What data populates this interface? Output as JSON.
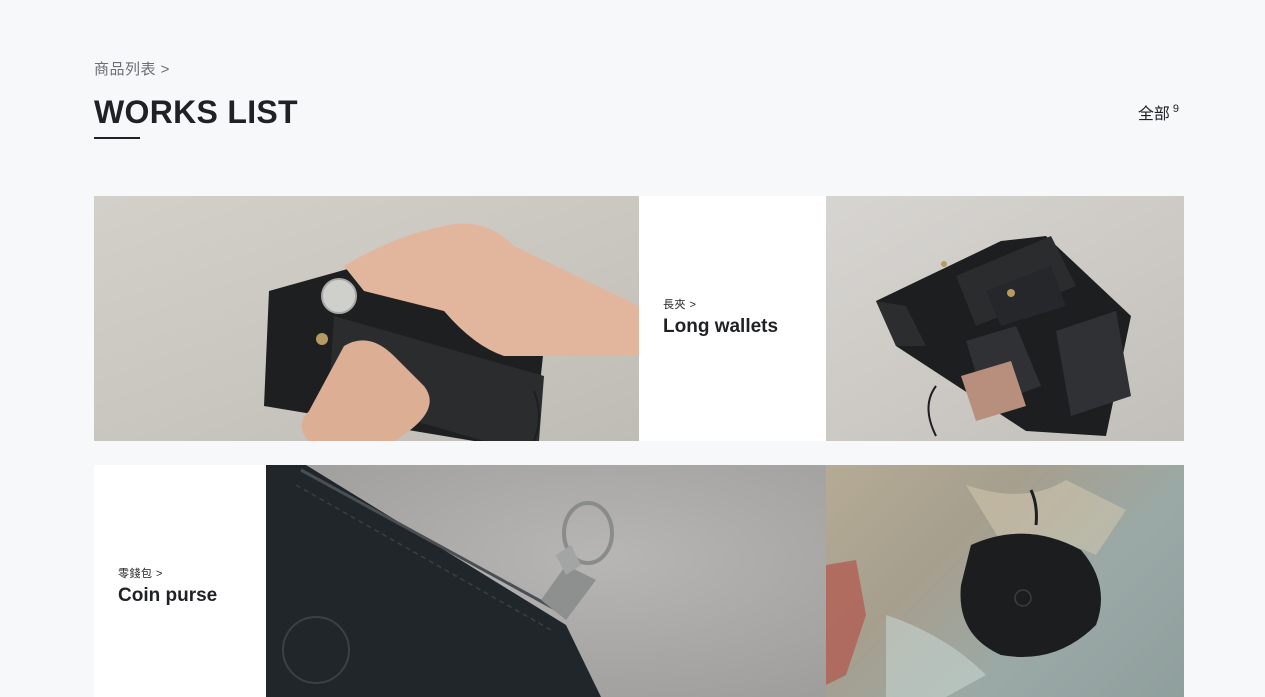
{
  "breadcrumb": "商品列表 >",
  "page_title": "WORKS LIST",
  "filter": {
    "label": "全部",
    "count": "9"
  },
  "categories": [
    {
      "zh": "長夾 >",
      "en": "Long wallets"
    },
    {
      "zh": "零錢包 >",
      "en": "Coin purse"
    }
  ],
  "colors": {
    "background": "#f7f8fa",
    "text": "#1f2124",
    "label_bg": "#ffffff"
  }
}
